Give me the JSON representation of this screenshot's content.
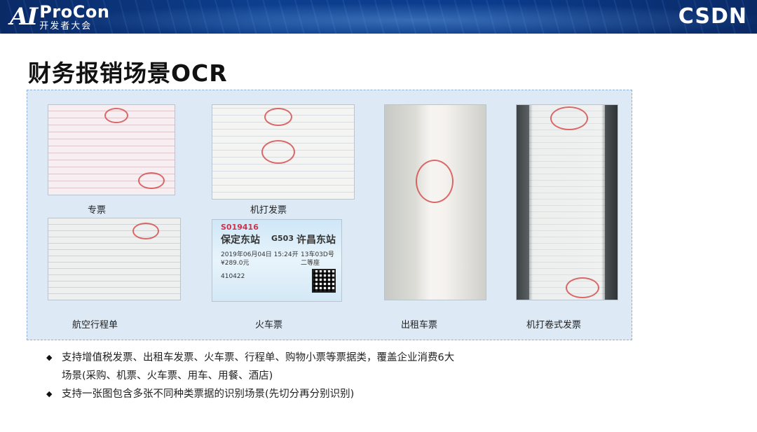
{
  "header": {
    "logo_mark": "AI",
    "logo_brand": "ProCon",
    "logo_sub": "开发者大会",
    "right_logo": "CSDN"
  },
  "title": "财务报销场景OCR",
  "captions": {
    "special_invoice": "专票",
    "machine_invoice": "机打发票",
    "taxi_ticket": "出租车票",
    "roll_invoice": "机打卷式发票",
    "itinerary": "航空行程单",
    "train_ticket": "火车票"
  },
  "train_ticket": {
    "code": "S019416",
    "from": "保定东站",
    "train_no": "G503",
    "to": "许昌东站",
    "date": "2019年06月04日 15:24开",
    "seat": "13车03D号",
    "price": "¥289.0元",
    "class": "二等座",
    "id_prefix": "410422"
  },
  "bullets": [
    {
      "lines": [
        "支持增值税发票、出租车发票、火车票、行程单、购物小票等票据类，覆盖企业消费6大",
        "场景(采购、机票、火车票、用车、用餐、酒店)"
      ]
    },
    {
      "lines": [
        "支持一张图包含多张不同种类票据的识别场景(先切分再分别识别)"
      ]
    }
  ]
}
